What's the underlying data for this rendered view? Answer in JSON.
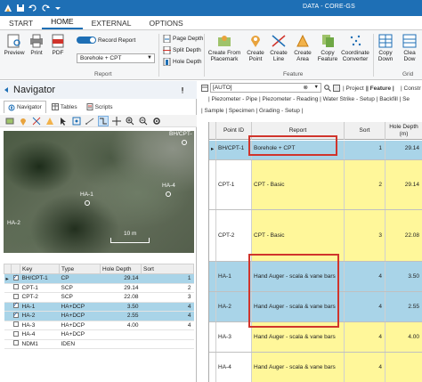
{
  "titlebar": {
    "title": "DATA - CORE-GS"
  },
  "ribbon_tabs": [
    "START",
    "HOME",
    "EXTERNAL",
    "OPTIONS"
  ],
  "ribbon": {
    "preview": "Preview",
    "print": "Print",
    "pdf": "PDF",
    "record_report": "Record Report",
    "report_select": "Borehole + CPT",
    "group_report": "Report",
    "page_depth": "Page Depth",
    "split_depth": "Split Depth",
    "hole_depth": "Hole Depth",
    "create_from_placemark": [
      "Create From",
      "Placemark"
    ],
    "create_point": [
      "Create",
      "Point"
    ],
    "create_line": [
      "Create",
      "Line"
    ],
    "create_area": [
      "Create",
      "Area"
    ],
    "copy_feature": [
      "Copy",
      "Feature"
    ],
    "coordinate_converter": [
      "Coordinate",
      "Converter"
    ],
    "copy_down": [
      "Copy",
      "Down"
    ],
    "clear_down": [
      "Clea",
      "Dow"
    ],
    "group_feature": "Feature",
    "group_grid": "Grid"
  },
  "navigator": {
    "title": "Navigator",
    "tabs": [
      "Navigator",
      "Tables",
      "Scripts"
    ],
    "map_labels": {
      "bh": "BH/CPT-",
      "ha1": "HA-1",
      "ha4": "HA-4",
      "ha2": "HA-2",
      "scale": "10 m"
    },
    "columns": [
      "Key",
      "Type",
      "Hole Depth",
      "Sort"
    ],
    "rows": [
      {
        "key": "BH/CPT-1",
        "type": "CP",
        "depth": "29.14",
        "sort": "1",
        "checked": true,
        "hl": true,
        "arrow": true
      },
      {
        "key": "CPT-1",
        "type": "SCP",
        "depth": "29.14",
        "sort": "2",
        "checked": false,
        "hl": false,
        "arrow": false
      },
      {
        "key": "CPT-2",
        "type": "SCP",
        "depth": "22.08",
        "sort": "3",
        "checked": false,
        "hl": false,
        "arrow": false
      },
      {
        "key": "HA-1",
        "type": "HA+DCP",
        "depth": "3.50",
        "sort": "4",
        "checked": true,
        "hl": true,
        "arrow": false
      },
      {
        "key": "HA-2",
        "type": "HA+DCP",
        "depth": "2.55",
        "sort": "4",
        "checked": true,
        "hl": true,
        "arrow": false
      },
      {
        "key": "HA-3",
        "type": "HA+DCP",
        "depth": "4.00",
        "sort": "4",
        "checked": false,
        "hl": false,
        "arrow": false
      },
      {
        "key": "HA-4",
        "type": "HA+DCP",
        "depth": "",
        "sort": "",
        "checked": false,
        "hl": false,
        "arrow": false
      },
      {
        "key": "NDM1",
        "type": "IDEN",
        "depth": "",
        "sort": "",
        "checked": false,
        "hl": false,
        "arrow": false
      }
    ]
  },
  "feature_pane": {
    "combo": "[AUTO]",
    "crumbs_1": [
      "| Project |",
      "| Feature |",
      "| Constr"
    ],
    "crumbs_2": "| Piezometer - Pipe | Piezometer - Reading | Water Strike - Setup | Backfill | Se",
    "crumbs_3": "| Sample | Specimen | Grading - Setup |",
    "columns": [
      "Point ID",
      "Report",
      "Sort",
      "Hole Depth (m)"
    ],
    "rows": [
      {
        "id": "BH/CPT-1",
        "report": "Borehole + CPT",
        "sort": "1",
        "depth": "29.14",
        "style": "blue"
      },
      {
        "id": "CPT-1",
        "report": "CPT - Basic",
        "sort": "2",
        "depth": "29.14",
        "style": "yellow"
      },
      {
        "id": "CPT-2",
        "report": "CPT - Basic",
        "sort": "3",
        "depth": "22.08",
        "style": "yellow"
      },
      {
        "id": "HA-1",
        "report": "Hand Auger - scala & vane bars",
        "sort": "4",
        "depth": "3.50",
        "style": "blue"
      },
      {
        "id": "HA-2",
        "report": "Hand Auger - scala & vane bars",
        "sort": "4",
        "depth": "2.55",
        "style": "blue"
      },
      {
        "id": "HA-3",
        "report": "Hand Auger - scala & vane bars",
        "sort": "4",
        "depth": "4.00",
        "style": "yellow"
      },
      {
        "id": "HA-4",
        "report": "Hand Auger - scala & vane bars",
        "sort": "4",
        "depth": "",
        "style": "yellow"
      }
    ]
  }
}
